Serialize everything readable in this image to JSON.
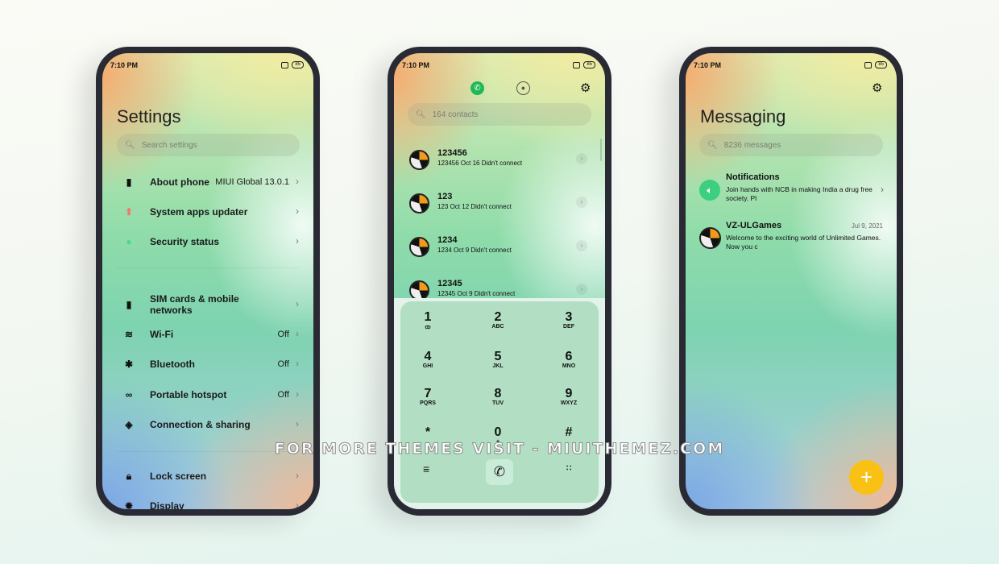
{
  "status": {
    "time": "7:10 PM",
    "battery": "85"
  },
  "settings": {
    "title": "Settings",
    "search_placeholder": "Search settings",
    "items": [
      {
        "icon": "phone-icon",
        "label": "About phone",
        "value": "MIUI Global 13.0.1"
      },
      {
        "icon": "arrow-up-icon",
        "label": "System apps updater",
        "value": ""
      },
      {
        "icon": "shield-icon",
        "label": "Security status",
        "value": ""
      },
      {
        "icon": "sim-card-icon",
        "label": "SIM cards & mobile networks",
        "value": ""
      },
      {
        "icon": "wifi-icon",
        "label": "Wi-Fi",
        "value": "Off"
      },
      {
        "icon": "bluetooth-icon",
        "label": "Bluetooth",
        "value": "Off"
      },
      {
        "icon": "hotspot-icon",
        "label": "Portable hotspot",
        "value": "Off"
      },
      {
        "icon": "connection-icon",
        "label": "Connection & sharing",
        "value": ""
      },
      {
        "icon": "lock-icon",
        "label": "Lock screen",
        "value": ""
      },
      {
        "icon": "brightness-icon",
        "label": "Display",
        "value": ""
      }
    ]
  },
  "dialer": {
    "search_placeholder": "164 contacts",
    "calls": [
      {
        "name": "123456",
        "detail": "123456  Oct 16 Didn't connect"
      },
      {
        "name": "123",
        "detail": "123  Oct 12 Didn't connect"
      },
      {
        "name": "1234",
        "detail": "1234  Oct 9 Didn't connect"
      },
      {
        "name": "12345",
        "detail": "12345  Oct 9 Didn't connect"
      }
    ],
    "keys": [
      {
        "d": "1",
        "l": "ꝏ"
      },
      {
        "d": "2",
        "l": "ABC"
      },
      {
        "d": "3",
        "l": "DEF"
      },
      {
        "d": "4",
        "l": "GHI"
      },
      {
        "d": "5",
        "l": "JKL"
      },
      {
        "d": "6",
        "l": "MNO"
      },
      {
        "d": "7",
        "l": "PQRS"
      },
      {
        "d": "8",
        "l": "TUV"
      },
      {
        "d": "9",
        "l": "WXYZ"
      },
      {
        "d": "*",
        "l": ","
      },
      {
        "d": "0",
        "l": "+"
      },
      {
        "d": "#",
        "l": ""
      }
    ],
    "accent": "#1db954"
  },
  "messaging": {
    "title": "Messaging",
    "search_placeholder": "8236 messages",
    "threads": [
      {
        "title": "Notifications",
        "date": "",
        "text": "Join hands with NCB in making India a drug free society. Pl"
      },
      {
        "title": "VZ-ULGames",
        "date": "Jul 9, 2021",
        "text": "Welcome to the exciting world of Unlimited Games. Now you c"
      }
    ],
    "fab_color": "#f9c113"
  },
  "watermark": "FOR MORE THEMES VISIT - MIUITHEMEZ.COM"
}
